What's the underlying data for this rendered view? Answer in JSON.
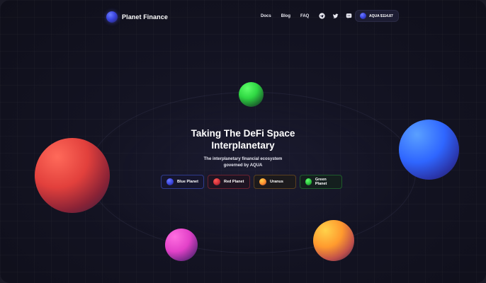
{
  "header": {
    "brand": "Planet Finance",
    "nav": [
      "Docs",
      "Blog",
      "FAQ"
    ],
    "social_icons": [
      "telegram-icon",
      "twitter-icon",
      "discord-icon"
    ],
    "token_badge": "AQUA $114.87"
  },
  "hero": {
    "title_line1": "Taking The DeFi Space",
    "title_line2": "Interplanetary",
    "subtitle_line1": "The interplanetary financial ecosystem",
    "subtitle_line2": "governed by AQUA"
  },
  "planet_buttons": [
    {
      "label": "Blue Planet",
      "color": "#3a45e0"
    },
    {
      "label": "Red Planet",
      "color": "#d0303a"
    },
    {
      "label": "Uranus",
      "color": "#ff8a2e"
    },
    {
      "label": "Green Planet",
      "color": "#2cc43f"
    }
  ],
  "colors": {
    "background": "#121220",
    "accent_blue": "#3a45e0"
  }
}
